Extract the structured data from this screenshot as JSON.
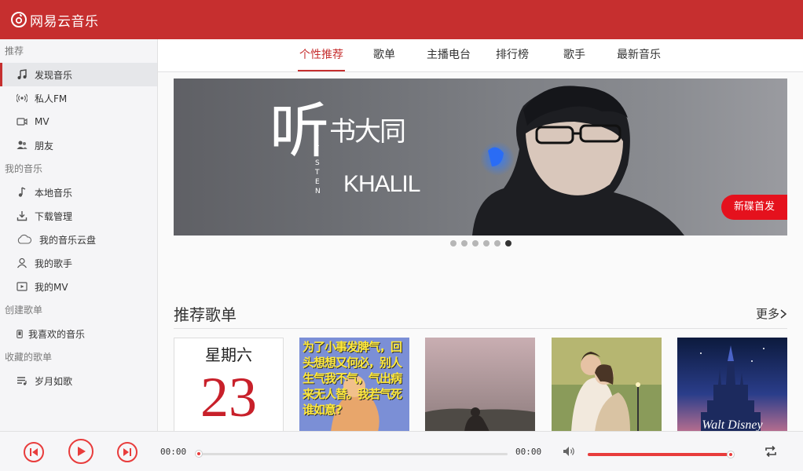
{
  "app": {
    "title": "网易云音乐"
  },
  "sidebar": {
    "sections": [
      {
        "title": "推荐",
        "items": [
          {
            "label": "发现音乐",
            "icon": "music-note-icon",
            "active": true
          },
          {
            "label": "私人FM",
            "icon": "radio-icon"
          },
          {
            "label": "MV",
            "icon": "video-icon"
          },
          {
            "label": "朋友",
            "icon": "friends-icon"
          }
        ]
      },
      {
        "title": "我的音乐",
        "items": [
          {
            "label": "本地音乐",
            "icon": "music-note-icon"
          },
          {
            "label": "下载管理",
            "icon": "download-icon"
          },
          {
            "label": "我的音乐云盘",
            "icon": "cloud-icon"
          },
          {
            "label": "我的歌手",
            "icon": "user-icon"
          },
          {
            "label": "我的MV",
            "icon": "play-box-icon"
          }
        ]
      },
      {
        "title": "创建歌单",
        "items": [
          {
            "label": "我喜欢的音乐",
            "icon": "phone-icon"
          }
        ]
      },
      {
        "title": "收藏的歌单",
        "items": [
          {
            "label": "岁月如歌",
            "icon": "playlist-icon"
          }
        ]
      }
    ]
  },
  "tabs": [
    "个性推荐",
    "歌单",
    "主播电台",
    "排行榜",
    "歌手",
    "最新音乐"
  ],
  "active_tab": "个性推荐",
  "banner": {
    "headline": "听",
    "album_art_text": "书大同",
    "vertical_text": "LISTEN",
    "artist_text": "KHALIL",
    "badge": "新碟首发"
  },
  "carousel": {
    "count": 6,
    "active_index": 5
  },
  "playlists": {
    "title": "推荐歌单",
    "more": "更多",
    "calendar": {
      "weekday": "星期六",
      "day": "23"
    },
    "card2_text": "为了小事发脾气，回头想想又何必，别人生气我不气，气出病来无人替。我若气死谁如意?"
  },
  "player": {
    "current_time": "00:00",
    "total_time": "00:00",
    "progress": 0.0,
    "volume": 0.98
  },
  "colors": {
    "brand": "#c62f2f",
    "accent": "#e83c3c",
    "badge": "#e5111d"
  }
}
